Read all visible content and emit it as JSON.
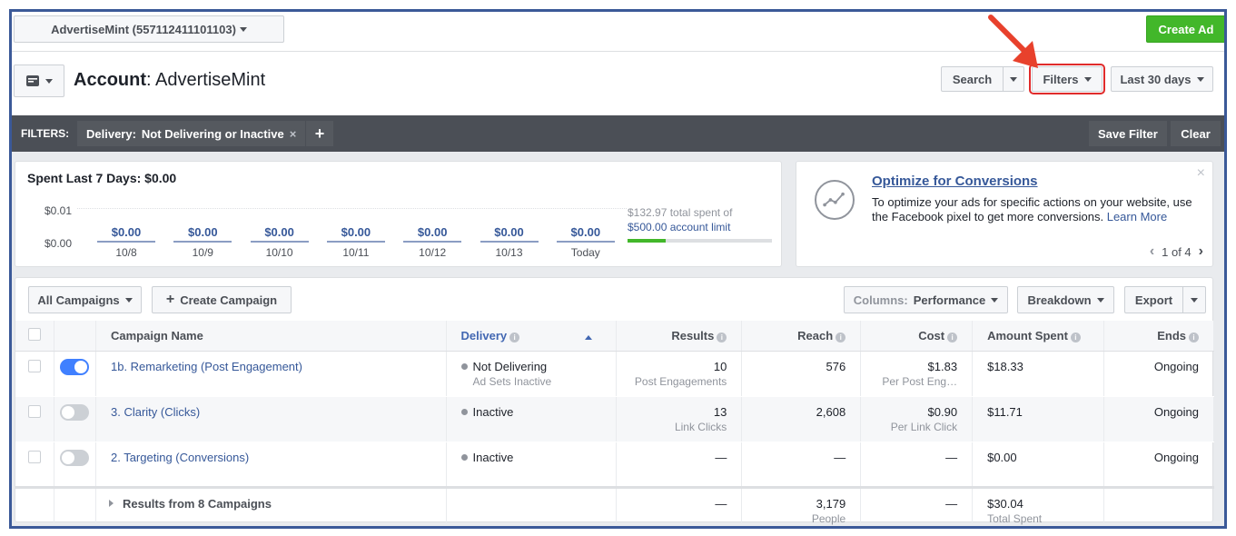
{
  "top": {
    "account_label": "AdvertiseMint (557112411101103)",
    "create_ad": "Create Ad"
  },
  "header": {
    "title_bold": "Account",
    "title_rest": ": AdvertiseMint",
    "search": "Search",
    "filters": "Filters",
    "date_range": "Last 30 days"
  },
  "filter_bar": {
    "label": "FILTERS:",
    "chip_key": "Delivery:",
    "chip_value": "Not Delivering or Inactive",
    "chip_remove": "×",
    "add": "+",
    "save": "Save Filter",
    "clear": "Clear"
  },
  "spend": {
    "title": "Spent Last 7 Days: $0.00",
    "y_top": "$0.01",
    "y_bottom": "$0.00",
    "days": [
      {
        "amount": "$0.00",
        "label": "10/8"
      },
      {
        "amount": "$0.00",
        "label": "10/9"
      },
      {
        "amount": "$0.00",
        "label": "10/10"
      },
      {
        "amount": "$0.00",
        "label": "10/11"
      },
      {
        "amount": "$0.00",
        "label": "10/12"
      },
      {
        "amount": "$0.00",
        "label": "10/13"
      },
      {
        "amount": "$0.00",
        "label": "Today"
      }
    ],
    "total_text": "$132.97 total spent of",
    "limit_text": "$500.00 account limit",
    "limit_fraction": 0.266
  },
  "tip": {
    "title": "Optimize for Conversions",
    "body": "To optimize your ads for specific actions on your website, use the Facebook pixel to get more conversions.",
    "link": "Learn More",
    "close": "×",
    "pager": "1 of 4",
    "prev": "‹",
    "next": "›"
  },
  "toolbar": {
    "all_campaigns": "All Campaigns",
    "create_plus": "+",
    "create": "Create Campaign",
    "columns_prefix": "Columns:",
    "columns_value": "Performance",
    "breakdown": "Breakdown",
    "export": "Export"
  },
  "table": {
    "headers": {
      "name": "Campaign Name",
      "delivery": "Delivery",
      "results": "Results",
      "reach": "Reach",
      "cost": "Cost",
      "amount": "Amount Spent",
      "ends": "Ends"
    },
    "rows": [
      {
        "on": true,
        "name": "1b. Remarketing (Post Engagement)",
        "delivery": "Not Delivering",
        "delivery_sub": "Ad Sets Inactive",
        "results": "10",
        "results_sub": "Post Engagements",
        "reach": "576",
        "cost": "$1.83",
        "cost_sub": "Per Post Eng…",
        "amount": "$18.33",
        "ends": "Ongoing"
      },
      {
        "on": false,
        "name": "3. Clarity (Clicks)",
        "delivery": "Inactive",
        "delivery_sub": "",
        "results": "13",
        "results_sub": "Link Clicks",
        "reach": "2,608",
        "cost": "$0.90",
        "cost_sub": "Per Link Click",
        "amount": "$11.71",
        "ends": "Ongoing"
      },
      {
        "on": false,
        "name": "2. Targeting (Conversions)",
        "delivery": "Inactive",
        "delivery_sub": "",
        "results": "—",
        "results_sub": "",
        "reach": "—",
        "cost": "—",
        "cost_sub": "",
        "amount": "$0.00",
        "ends": "Ongoing"
      }
    ],
    "footer": {
      "label": "Results from 8 Campaigns",
      "results": "—",
      "reach": "3,179",
      "reach_sub": "People",
      "cost": "—",
      "amount": "$30.04",
      "amount_sub": "Total Spent"
    }
  },
  "colors": {
    "accent": "#4267b2",
    "green": "#42b72a",
    "filter_bar": "#4b4f56",
    "highlight": "#e02b2b"
  }
}
